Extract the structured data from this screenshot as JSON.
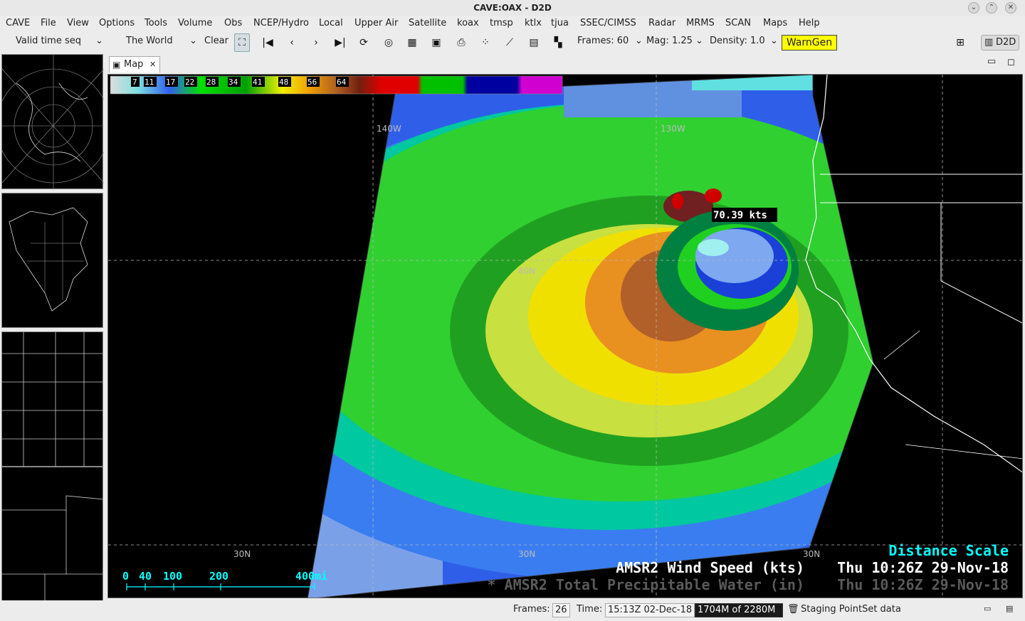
{
  "window": {
    "title": "CAVE:OAX - D2D"
  },
  "menubar": {
    "items": [
      "CAVE",
      "File",
      "View",
      "Options",
      "Tools",
      "Volume",
      "Obs",
      "NCEP/Hydro",
      "Local",
      "Upper Air",
      "Satellite",
      "koax",
      "tmsp",
      "ktlx",
      "tjua",
      "SSEC/CIMSS",
      "Radar",
      "MRMS",
      "SCAN",
      "Maps",
      "Help"
    ]
  },
  "toolbar": {
    "time_mode": "Valid time seq",
    "scale": "The World",
    "clear_label": "Clear",
    "frames_label": "Frames: 60",
    "mag_label": "Mag: 1.25",
    "density_label": "Density: 1.0",
    "warngen_label": "WarnGen",
    "perspective_label": "D2D"
  },
  "tab": {
    "label": "Map"
  },
  "colorbar": {
    "labels": [
      "7",
      "11",
      "17",
      "22",
      "28",
      "34",
      "41",
      "48",
      "56",
      "64"
    ]
  },
  "map": {
    "lon_labels": [
      "140W",
      "130W"
    ],
    "lat_labels": [
      "40N",
      "30N",
      "30N",
      "30N"
    ],
    "sample_readout": "70.39 kts",
    "distance_scale_title": "Distance Scale",
    "scale_ticks": [
      "0",
      "40",
      "100",
      "200",
      "400mi"
    ],
    "legend": [
      {
        "name": "AMSR2 Wind Speed (kts)",
        "time": "Thu 10:26Z 29-Nov-18",
        "color": "#ffffff"
      },
      {
        "name": "* AMSR2 Total Precipitable Water (in)",
        "time": "Thu 10:26Z 29-Nov-18",
        "color": "#5a5a5a"
      }
    ],
    "colors": {
      "text_cyan": "#00ffff",
      "lat_lon_labels": "#bbbbbb"
    }
  },
  "statusbar": {
    "frames_label": "Frames:",
    "frames_value": "26",
    "time_label": "Time:",
    "time_value": "15:13Z 02-Dec-18",
    "memory": "1704M of 2280M",
    "message": "Staging PointSet data"
  }
}
